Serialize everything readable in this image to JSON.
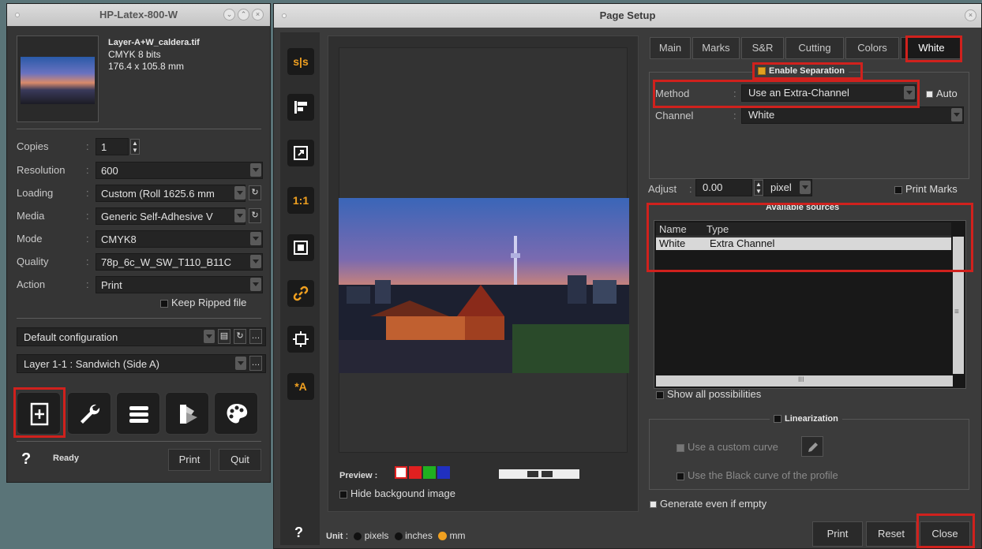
{
  "left_window": {
    "title": "HP-Latex-800-W",
    "file": {
      "name": "Layer-A+W_caldera.tif",
      "mode": "CMYK 8 bits",
      "size": "176.4 x 105.8 mm"
    },
    "fields": {
      "copies_label": "Copies",
      "copies_value": "1",
      "resolution_label": "Resolution",
      "resolution_value": "600",
      "loading_label": "Loading",
      "loading_value": "Custom (Roll 1625.6 mm",
      "media_label": "Media",
      "media_value": "Generic Self-Adhesive V",
      "mode_label": "Mode",
      "mode_value": "CMYK8",
      "quality_label": "Quality",
      "quality_value": "78p_6c_W_SW_T110_B11C",
      "action_label": "Action",
      "action_value": "Print",
      "colon": ":"
    },
    "keep_ripped_label": "Keep Ripped file",
    "config_value": "Default configuration",
    "layer_value": "Layer 1-1 : Sandwich (Side A)",
    "status_help": "?",
    "status_text": "Ready",
    "print_label": "Print",
    "quit_label": "Quit"
  },
  "main_window": {
    "title": "Page Setup",
    "toolbar": {
      "swap_label": "s|s",
      "actual_size_label": "1:1",
      "auto_label": "*A"
    },
    "tabs": [
      "Main",
      "Marks",
      "S&R",
      "Cutting",
      "Colors",
      "White"
    ],
    "active_tab": "White",
    "enable_separation_label": "Enable Separation",
    "method_label": "Method",
    "method_value": "Use an Extra-Channel",
    "auto_label": "Auto",
    "channel_label": "Channel",
    "channel_value": "White",
    "colon": ":",
    "adjust_label": "Adjust",
    "adjust_value": "0.00",
    "adjust_unit": "pixel",
    "print_marks_label": "Print Marks",
    "available_sources_label": "Available sources",
    "sources_headers": [
      "Name",
      "Type"
    ],
    "sources_rows": [
      {
        "name": "White",
        "type": "Extra Channel"
      }
    ],
    "hscroll_grip": "III",
    "vscroll_grip": "≡",
    "show_all_label": "Show all possibilities",
    "linearization_label": "Linearization",
    "custom_curve_label": "Use a custom curve",
    "black_curve_label": "Use the Black curve of the profile",
    "generate_empty_label": "Generate even if empty",
    "preview_label": "Preview",
    "preview_colors": [
      "#ffffff",
      "#e02020",
      "#20b020",
      "#2030c0"
    ],
    "hide_bg_label": "Hide backgound image",
    "help_label": "?",
    "unit_label": "Unit",
    "unit_options": [
      "pixels",
      "inches",
      "mm"
    ],
    "unit_selected": "mm",
    "print_label": "Print",
    "reset_label": "Reset",
    "close_label": "Close"
  }
}
